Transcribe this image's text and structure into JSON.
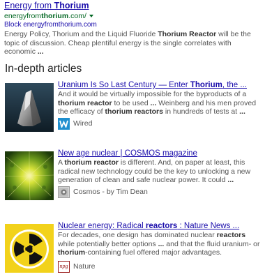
{
  "top_result": {
    "title_pre": "Energy from ",
    "title_bold": "Thorium",
    "url_pre": "energyfrom",
    "url_bold": "thorium",
    "url_post": ".com/",
    "block_link": "Block energyfromthorium.com",
    "snippet_1": "Energy Policy, Thorium and the Liquid Fluoride ",
    "snippet_bold": "Thorium Reactor",
    "snippet_2": " will be the topic of discussion. Cheap plentiful energy is the single correlates with economic ",
    "snippet_ellipsis": "..."
  },
  "section": {
    "heading": "In-depth articles"
  },
  "articles": [
    {
      "title_pre": "Uranium Is So Last Century — Enter ",
      "title_bold": "Thorium",
      "title_post": ", the ...",
      "snippet_1": "And it would be virtually impossible for the byproducts of a ",
      "snippet_b1": "thorium reactor",
      "snippet_2": " to be used ",
      "snippet_e1": "...",
      "snippet_3": " Weinberg and his men proved the efficacy of ",
      "snippet_b2": "thorium reactors",
      "snippet_4": " in hundreds of tests at ",
      "snippet_e2": "...",
      "source": "Wired",
      "logo_icon": "wired-logo-icon",
      "logo_color": "#1f8fcf"
    },
    {
      "title_pre": "New age nuclear | COSMOS magazine",
      "snippet_1": "A ",
      "snippet_b1": "thorium reactor",
      "snippet_2": " is different. And, on paper at least, this radical new technology could be the key to unlocking a new generation of clean and safe nuclear power. It could ",
      "snippet_e1": "...",
      "source": "Cosmos - by Tim Dean",
      "logo_icon": "cosmos-logo-icon",
      "logo_color": "#d9d9d9"
    },
    {
      "title_pre": "Nuclear energy: Radical ",
      "title_bold": "reactors",
      "title_post": " : Nature News ...",
      "snippet_1": "For decades, one design has dominated nuclear ",
      "snippet_b1": "reactors",
      "snippet_2": " while potentially better options ",
      "snippet_e1": "...",
      "snippet_3": " and that the fluid uranium- or ",
      "snippet_b2": "thorium",
      "snippet_4": "-containing fuel offered major advantages.",
      "source": "Nature",
      "logo_icon": "nature-logo-icon",
      "logo_text": "npg",
      "logo_color": "#9a1b1b"
    }
  ],
  "colors": {
    "link": "#1a0dab",
    "url_green": "#006621",
    "snippet": "#545454",
    "radiation_yellow": "#f2d21b"
  }
}
